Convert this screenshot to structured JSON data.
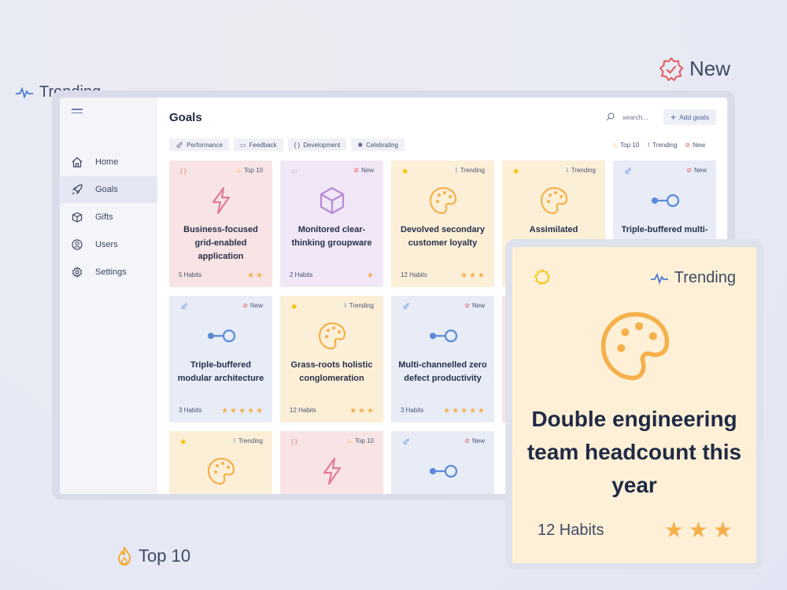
{
  "floating_tags": {
    "trending": "Trending",
    "new": "New",
    "top10": "Top 10"
  },
  "sidebar": {
    "items": [
      {
        "label": "Home",
        "icon": "home-icon"
      },
      {
        "label": "Goals",
        "icon": "rocket-icon",
        "active": true
      },
      {
        "label": "Gifts",
        "icon": "box-icon"
      },
      {
        "label": "Users",
        "icon": "users-icon"
      },
      {
        "label": "Settings",
        "icon": "gear-icon"
      }
    ]
  },
  "header": {
    "title": "Goals",
    "search_placeholder": "search...",
    "add_label": "Add goals"
  },
  "filters": [
    "Performance",
    "Feedback",
    "Development",
    "Celebrating"
  ],
  "legend": [
    "Top 10",
    "Trending",
    "New"
  ],
  "cards": [
    {
      "tag": "Top 10",
      "title": "Business-focused grid-enabled application",
      "habits": "5 Habits",
      "stars": "★★"
    },
    {
      "tag": "New",
      "title": "Monitored clear-thinking groupware",
      "habits": "2 Habits",
      "stars": "★"
    },
    {
      "tag": "Trending",
      "title": "Devolved secondary customer loyalty",
      "habits": "12 Habits",
      "stars": "★★★"
    },
    {
      "tag": "Trending",
      "title": "Assimilated methodical analyzer",
      "habits": "",
      "stars": ""
    },
    {
      "tag": "New",
      "title": "Triple-buffered multi-tasking",
      "habits": "",
      "stars": ""
    },
    {
      "tag": "New",
      "title": "Triple-buffered modular architecture",
      "habits": "3 Habits",
      "stars": "★★★★★"
    },
    {
      "tag": "Trending",
      "title": "Grass-roots holistic conglomeration",
      "habits": "12 Habits",
      "stars": "★★★"
    },
    {
      "tag": "New",
      "title": "Multi-channelled zero defect productivity",
      "habits": "3 Habits",
      "stars": "★★★★★"
    },
    {
      "tag": "Trending",
      "title": "",
      "habits": "",
      "stars": ""
    },
    {
      "tag": "Top 10",
      "title": "",
      "habits": "",
      "stars": ""
    },
    {
      "tag": "New",
      "title": "",
      "habits": "",
      "stars": ""
    }
  ],
  "big_card": {
    "tag": "Trending",
    "title": "Double engineering team headcount this year",
    "habits": "12 Habits",
    "stars": "★★★"
  },
  "colors": {
    "star": "#f5b04b",
    "top10": "#f5a623",
    "new": "#e55a5a",
    "trending": "#4a7bd0",
    "sun": "#f2c200"
  }
}
